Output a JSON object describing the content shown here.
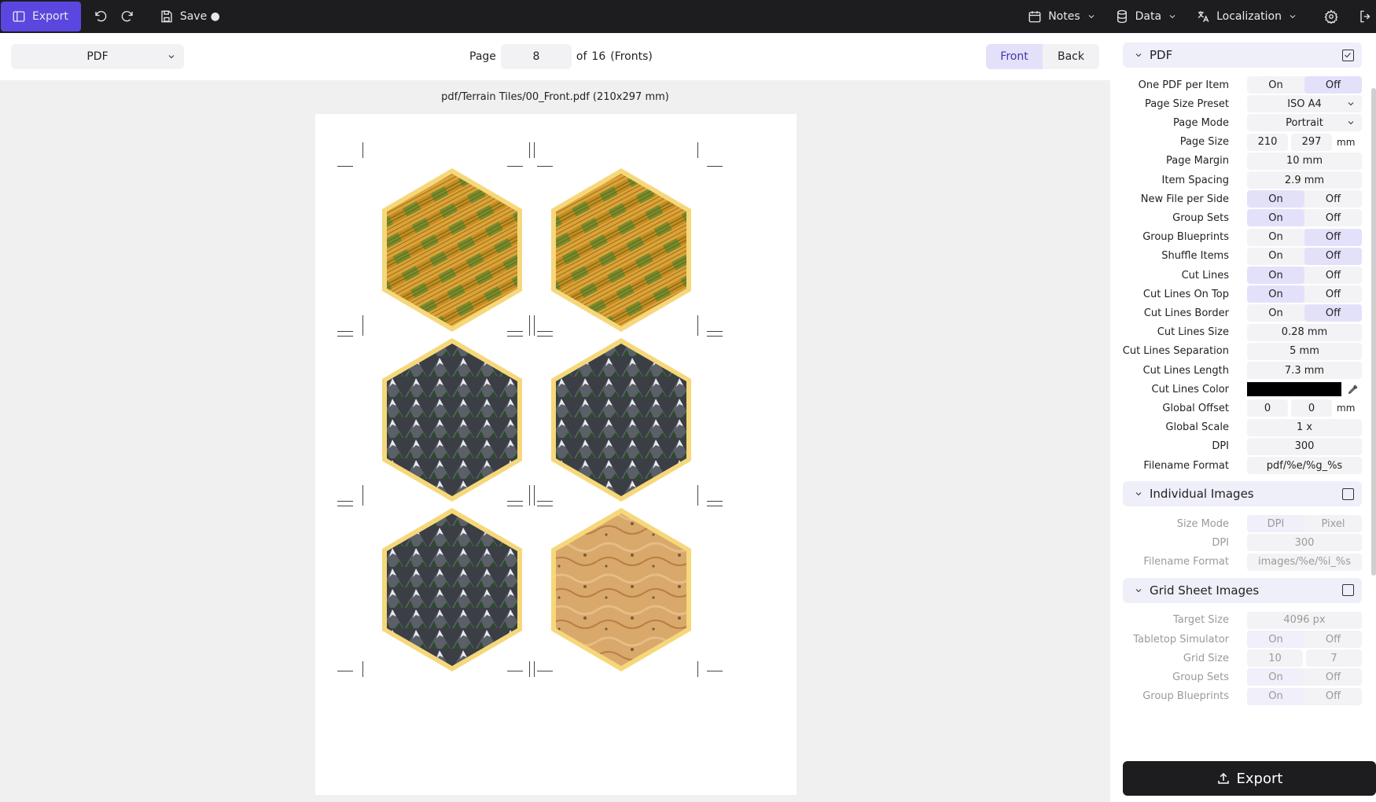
{
  "topbar": {
    "export": "Export",
    "save": "Save ●",
    "notes": "Notes",
    "data": "Data",
    "localization": "Localization"
  },
  "toolbar": {
    "format": "PDF",
    "page_label": "Page",
    "page_value": "8",
    "of_label": "of",
    "page_total": "16",
    "side_note": "(Fronts)",
    "front": "Front",
    "back": "Back"
  },
  "canvas": {
    "filename": "pdf/Terrain Tiles/00_Front.pdf (210x297 mm)"
  },
  "tiles": [
    "fields",
    "fields",
    "mountains",
    "mountains",
    "mountains",
    "desert"
  ],
  "panel": {
    "pdf_title": "PDF",
    "pdf_rows": [
      {
        "label": "One PDF per Item",
        "type": "toggle",
        "a": "On",
        "b": "Off",
        "on": "b"
      },
      {
        "label": "Page Size Preset",
        "type": "select",
        "value": "ISO A4"
      },
      {
        "label": "Page Mode",
        "type": "select",
        "value": "Portrait"
      },
      {
        "label": "Page Size",
        "type": "two",
        "a": "210",
        "b": "297",
        "unit": "mm"
      },
      {
        "label": "Page Margin",
        "type": "text",
        "value": "10 mm"
      },
      {
        "label": "Item Spacing",
        "type": "text",
        "value": "2.9 mm"
      },
      {
        "label": "New File per Side",
        "type": "toggle",
        "a": "On",
        "b": "Off",
        "on": "a"
      },
      {
        "label": "Group Sets",
        "type": "toggle",
        "a": "On",
        "b": "Off",
        "on": "a"
      },
      {
        "label": "Group Blueprints",
        "type": "toggle",
        "a": "On",
        "b": "Off",
        "on": "b"
      },
      {
        "label": "Shuffle Items",
        "type": "toggle",
        "a": "On",
        "b": "Off",
        "on": "b"
      },
      {
        "label": "Cut Lines",
        "type": "toggle",
        "a": "On",
        "b": "Off",
        "on": "a"
      },
      {
        "label": "Cut Lines On Top",
        "type": "toggle",
        "a": "On",
        "b": "Off",
        "on": "a"
      },
      {
        "label": "Cut Lines Border",
        "type": "toggle",
        "a": "On",
        "b": "Off",
        "on": "b"
      },
      {
        "label": "Cut Lines Size",
        "type": "text",
        "value": "0.28 mm"
      },
      {
        "label": "Cut Lines Separation",
        "type": "text",
        "value": "5 mm"
      },
      {
        "label": "Cut Lines Length",
        "type": "text",
        "value": "7.3 mm"
      },
      {
        "label": "Cut Lines Color",
        "type": "color",
        "value": "#000000"
      },
      {
        "label": "Global Offset",
        "type": "two",
        "a": "0",
        "b": "0",
        "unit": "mm"
      },
      {
        "label": "Global Scale",
        "type": "text",
        "value": "1 x"
      },
      {
        "label": "DPI",
        "type": "text",
        "value": "300"
      },
      {
        "label": "Filename Format",
        "type": "text",
        "value": "pdf/%e/%g_%s"
      }
    ],
    "individual_title": "Individual Images",
    "individual_rows": [
      {
        "label": "Size Mode",
        "type": "toggle",
        "a": "DPI",
        "b": "Pixel",
        "on": "a"
      },
      {
        "label": "DPI",
        "type": "text",
        "value": "300"
      },
      {
        "label": "Filename Format",
        "type": "text",
        "value": "images/%e/%i_%s"
      }
    ],
    "grid_title": "Grid Sheet Images",
    "grid_rows": [
      {
        "label": "Target Size",
        "type": "text",
        "value": "4096 px"
      },
      {
        "label": "Tabletop Simulator",
        "type": "toggle",
        "a": "On",
        "b": "Off",
        "on": "a"
      },
      {
        "label": "Grid Size",
        "type": "two",
        "a": "10",
        "b": "7"
      },
      {
        "label": "Group Sets",
        "type": "toggle",
        "a": "On",
        "b": "Off",
        "on": "a"
      },
      {
        "label": "Group Blueprints",
        "type": "toggle",
        "a": "On",
        "b": "Off",
        "on": "a"
      }
    ],
    "export_button": "Export"
  }
}
